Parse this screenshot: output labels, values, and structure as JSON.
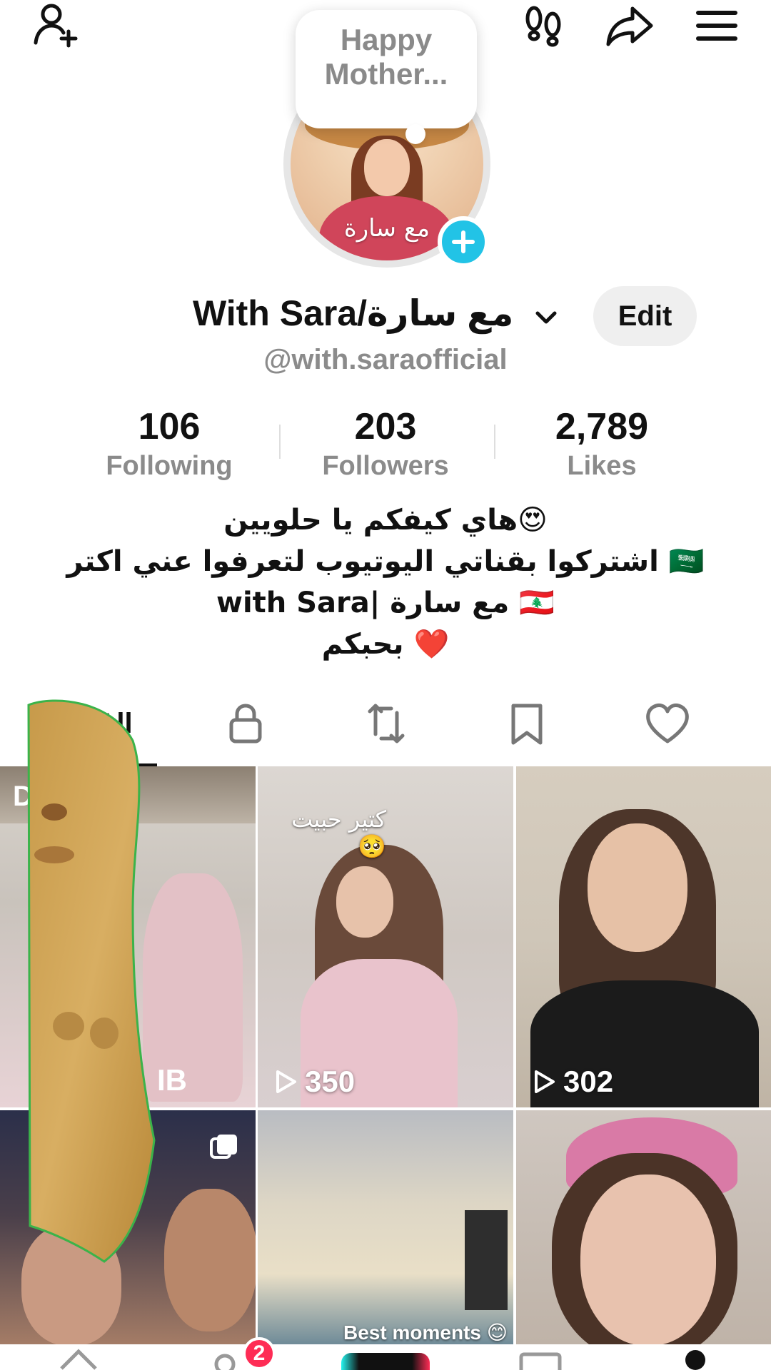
{
  "story_bubble": {
    "line1": "Happy",
    "line2": "Mother..."
  },
  "profile": {
    "avatar_text": "مع سارة",
    "display_name": "With Sara/مع سارة",
    "edit_label": "Edit",
    "handle": "@with.saraofficial"
  },
  "stats": [
    {
      "value": "106",
      "label": "Following"
    },
    {
      "value": "203",
      "label": "Followers"
    },
    {
      "value": "2,789",
      "label": "Likes"
    }
  ],
  "bio": {
    "line1": "هاي كيفكم يا حلويين😍",
    "line2": "اشتركوا بقناتي اليوتيوب لتعرفوا عني اكتر 🇸🇦",
    "line3": "with Sara| مع سارة 🇱🇧",
    "line4": "بحبكم ❤️"
  },
  "tabs": {
    "videos_label": "All"
  },
  "grid": {
    "tile1": {
      "corner_text": "D",
      "views": "IB"
    },
    "tile2": {
      "caption": "كتير حبيت 🥺",
      "views": "350"
    },
    "tile3": {
      "views": "302"
    },
    "tile5": {
      "caption": "Best moments 😊"
    }
  },
  "bottom_nav": {
    "inbox_badge": "2"
  },
  "colors": {
    "accent": "#22c3e6",
    "badge": "#fe2c55",
    "muted": "#8b8b8b"
  },
  "icons": [
    "add-friend-icon",
    "footprints-icon",
    "share-icon",
    "menu-icon",
    "lock-icon",
    "repost-icon",
    "bookmark-icon",
    "heart-icon",
    "play-icon",
    "carousel-icon"
  ]
}
